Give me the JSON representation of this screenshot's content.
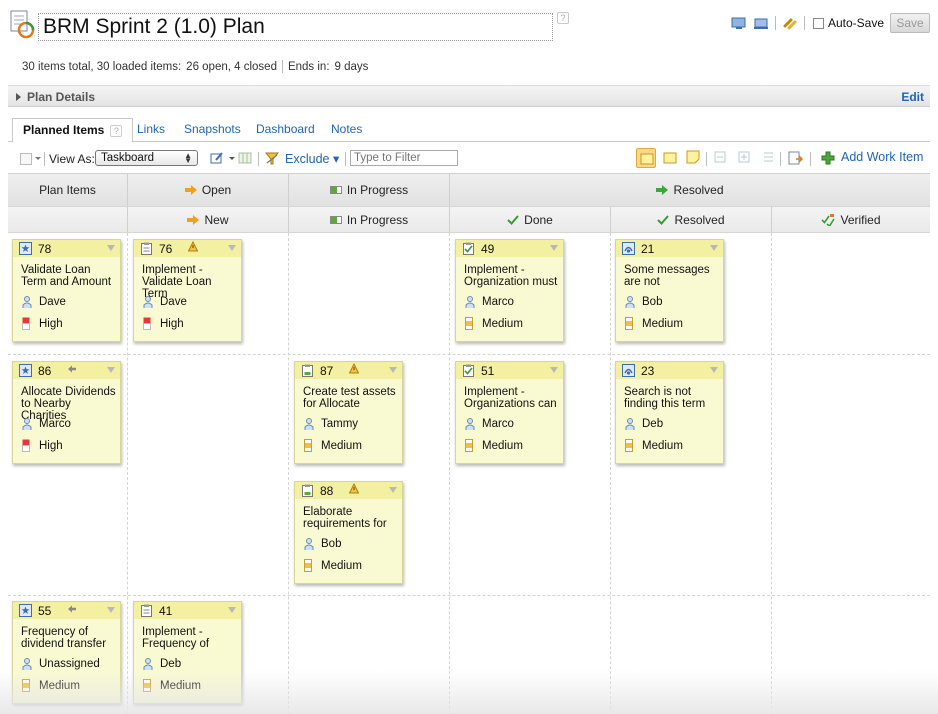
{
  "header": {
    "title": "BRM Sprint 2 (1.0) Plan",
    "help_glyph": "?",
    "autosave_label": "Auto-Save",
    "save_label": "Save"
  },
  "summary": {
    "totals": "30 items total, 30 loaded items:",
    "open_closed": "26 open, 4 closed",
    "ends_label": "Ends in:",
    "ends_value": "9 days"
  },
  "details": {
    "label": "Plan Details",
    "edit_label": "Edit"
  },
  "tabs": [
    {
      "label": "Planned Items"
    },
    {
      "label": "Links"
    },
    {
      "label": "Snapshots"
    },
    {
      "label": "Dashboard"
    },
    {
      "label": "Notes"
    }
  ],
  "toolbar": {
    "view_as_label": "View As:",
    "view_as_value": "Taskboard",
    "exclude_label": "Exclude",
    "filter_placeholder": "Type to Filter",
    "add_work_item_label": "Add Work Item"
  },
  "board": {
    "first_column": "Plan Items",
    "groups": [
      {
        "label": "Open",
        "icon": "arrow-right-orange-icon"
      },
      {
        "label": "In Progress",
        "icon": "progress-bar-icon"
      },
      {
        "label": "Resolved",
        "icon": "arrow-right-green-icon"
      }
    ],
    "states": [
      {
        "label": "New",
        "icon": "arrow-right-orange-icon"
      },
      {
        "label": "In Progress",
        "icon": "progress-bar-icon"
      },
      {
        "label": "Done",
        "icon": "check-icon"
      },
      {
        "label": "Resolved",
        "icon": "check-icon"
      },
      {
        "label": "Verified",
        "icon": "verified-icon"
      }
    ],
    "cards": [
      {
        "id": "78",
        "title": "Validate Loan Term and Amount",
        "owner": "Dave",
        "priority": "High",
        "type": "story"
      },
      {
        "id": "76",
        "title": "Implement - Validate Loan Term",
        "owner": "Dave",
        "priority": "High",
        "type": "task",
        "flag": "warning"
      },
      {
        "id": "49",
        "title": "Implement - Organization must",
        "owner": "Marco",
        "priority": "Medium",
        "type": "task-done"
      },
      {
        "id": "21",
        "title": "Some messages are not",
        "owner": "Bob",
        "priority": "Medium",
        "type": "defect"
      },
      {
        "id": "86",
        "title": "Allocate Dividends to Nearby Charities",
        "owner": "Marco",
        "priority": "High",
        "type": "story",
        "flag": "back"
      },
      {
        "id": "87",
        "title": "Create test assets for Allocate",
        "owner": "Tammy",
        "priority": "Medium",
        "type": "task-progress",
        "flag": "warning"
      },
      {
        "id": "51",
        "title": "Implement - Organizations can",
        "owner": "Marco",
        "priority": "Medium",
        "type": "task-done"
      },
      {
        "id": "23",
        "title": "Search is not finding this term",
        "owner": "Deb",
        "priority": "Medium",
        "type": "defect"
      },
      {
        "id": "88",
        "title": "Elaborate requirements for",
        "owner": "Bob",
        "priority": "Medium",
        "type": "task-progress",
        "flag": "warning"
      },
      {
        "id": "55",
        "title": "Frequency of dividend transfer",
        "owner": "Unassigned",
        "priority": "Medium",
        "type": "story",
        "flag": "back"
      },
      {
        "id": "41",
        "title": "Implement - Frequency of",
        "owner": "Deb",
        "priority": "Medium",
        "type": "task"
      }
    ]
  },
  "colors": {
    "link": "#1f65b3",
    "card_bg": "#fafad2",
    "card_header": "#f3f0a2",
    "priority_high": "#e03a3a",
    "priority_medium": "#f0c040"
  }
}
